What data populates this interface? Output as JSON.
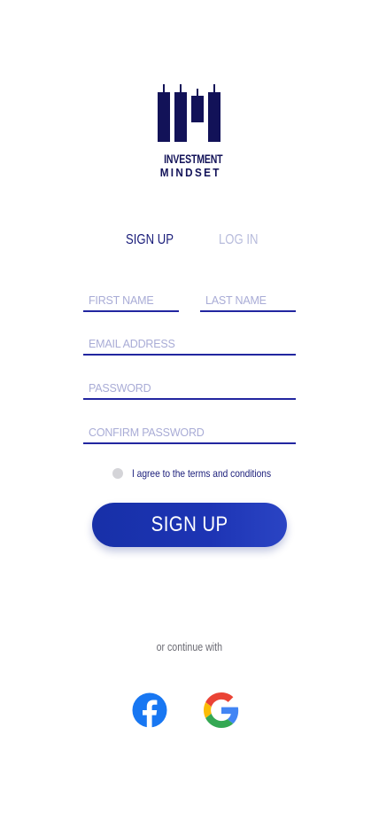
{
  "brand": {
    "line1": "INVESTMENT",
    "line2": "MINDSET",
    "logo_icon": "candlestick-chart-icon",
    "color": "#121258"
  },
  "tabs": [
    {
      "label": "SIGN UP",
      "active": true
    },
    {
      "label": "LOG IN",
      "active": false
    }
  ],
  "form": {
    "first_name_placeholder": "FIRST NAME",
    "last_name_placeholder": "LAST NAME",
    "email_placeholder": "EMAIL ADDRESS",
    "password_placeholder": "PASSWORD",
    "confirm_password_placeholder": "CONFIRM PASSWORD",
    "agree_text": "I agree to the terms and conditions",
    "agree_checked": false,
    "submit_label": "SIGN UP"
  },
  "social": {
    "continue_text": "or continue with",
    "providers": [
      {
        "name": "facebook",
        "icon": "facebook-icon",
        "color": "#1877f2"
      },
      {
        "name": "google",
        "icon": "google-icon"
      }
    ]
  },
  "colors": {
    "accent": "#1d34b4",
    "text": "#1a1d7a",
    "inactive_tab": "#b8bcdc",
    "placeholder": "#a9acd6"
  }
}
